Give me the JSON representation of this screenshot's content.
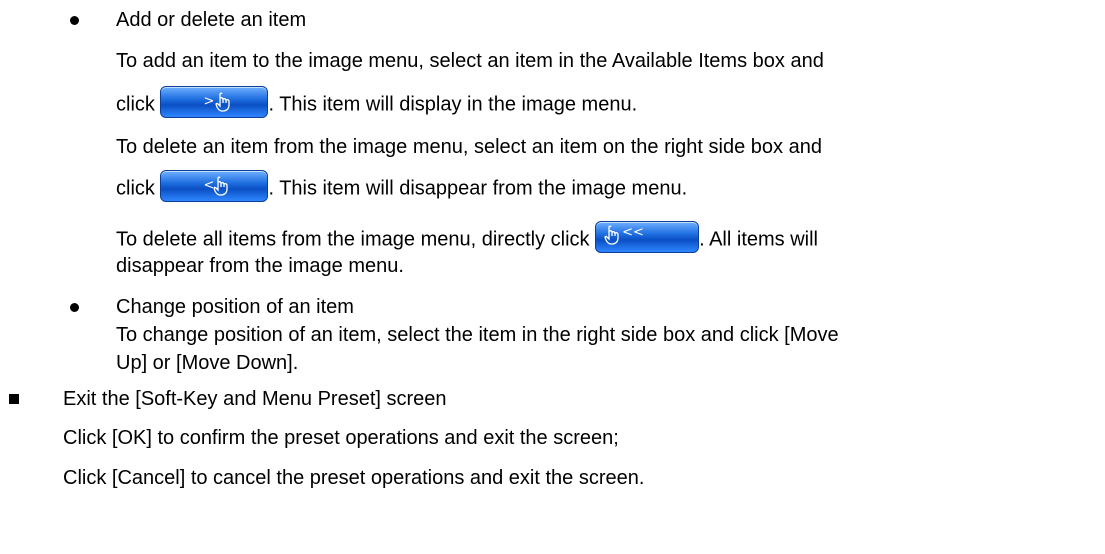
{
  "section_add_delete": {
    "bullet_title": "Add or delete an item",
    "add_line1": "To add an item to the image menu, select an item in the Available Items box and",
    "add_click": "click",
    "add_after": ". This item will display in the image menu.",
    "delete_line1": "To delete an item from the image menu, select an item on the right side box and",
    "delete_click": "click",
    "delete_after": ". This item will disappear from the image menu.",
    "delete_all_before": "To delete all items from the image menu, directly click",
    "delete_all_after": ". All items will",
    "delete_all_line2": "disappear from the image menu."
  },
  "section_position": {
    "bullet_title": "Change position of an item",
    "line1": "To change position of an item, select the item in the right side box and click [Move",
    "line2": "Up] or [Move Down]."
  },
  "section_exit": {
    "bullet_title": "Exit the [Soft-Key and Menu Preset] screen",
    "line1": "Click [OK] to confirm the preset operations and exit the screen;",
    "line2": "Click [Cancel] to cancel the preset operations and exit the screen."
  },
  "buttons": {
    "add_glyph": ">",
    "remove_glyph": "<",
    "remove_all_glyph": "<<",
    "icon": "hand-pointer-icon",
    "color_top": "#6fb0ff",
    "color_bottom": "#0a4fc4"
  }
}
